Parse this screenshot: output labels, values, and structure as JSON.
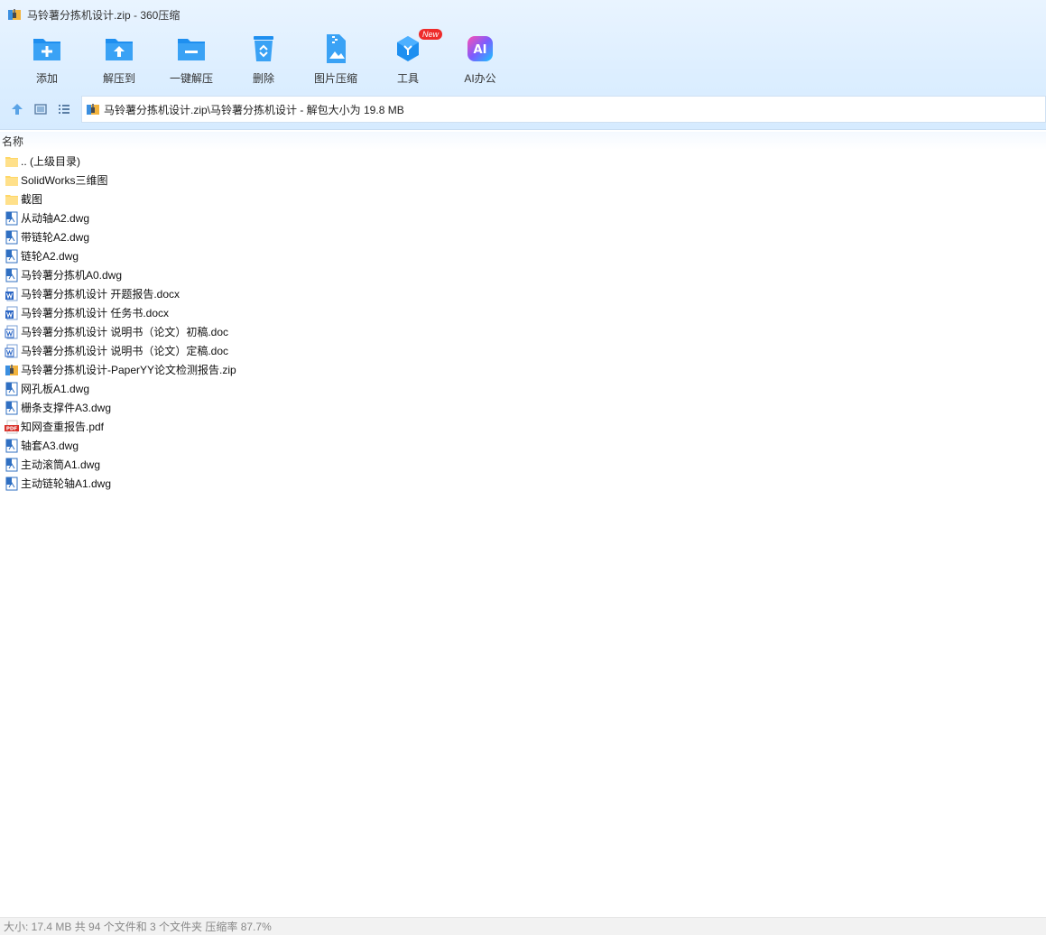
{
  "window": {
    "title": "马铃薯分拣机设计.zip - 360压缩"
  },
  "toolbar": {
    "items": [
      {
        "label": "添加",
        "icon": "add-folder-icon"
      },
      {
        "label": "解压到",
        "icon": "extract-to-icon"
      },
      {
        "label": "一键解压",
        "icon": "one-click-extract-icon"
      },
      {
        "label": "删除",
        "icon": "delete-icon"
      },
      {
        "label": "图片压缩",
        "icon": "image-compress-icon"
      },
      {
        "label": "工具",
        "icon": "tools-icon",
        "badge": "New"
      },
      {
        "label": "AI办公",
        "icon": "ai-office-icon",
        "glyph": "AI"
      }
    ]
  },
  "address": {
    "path": "马铃薯分拣机设计.zip\\马铃薯分拣机设计 - 解包大小为 19.8 MB"
  },
  "list": {
    "column_name": "名称",
    "items": [
      {
        "name": ".. (上级目录)",
        "type": "folder"
      },
      {
        "name": "SolidWorks三维图",
        "type": "folder"
      },
      {
        "name": "截图",
        "type": "folder"
      },
      {
        "name": "从动轴A2.dwg",
        "type": "dwg"
      },
      {
        "name": "带链轮A2.dwg",
        "type": "dwg"
      },
      {
        "name": "链轮A2.dwg",
        "type": "dwg"
      },
      {
        "name": "马铃薯分拣机A0.dwg",
        "type": "dwg"
      },
      {
        "name": "马铃薯分拣机设计 开题报告.docx",
        "type": "docx"
      },
      {
        "name": "马铃薯分拣机设计 任务书.docx",
        "type": "docx"
      },
      {
        "name": "马铃薯分拣机设计 说明书（论文）初稿.doc",
        "type": "doc"
      },
      {
        "name": "马铃薯分拣机设计 说明书（论文）定稿.doc",
        "type": "doc"
      },
      {
        "name": "马铃薯分拣机设计-PaperYY论文检测报告.zip",
        "type": "zip"
      },
      {
        "name": "网孔板A1.dwg",
        "type": "dwg"
      },
      {
        "name": "栅条支撑件A3.dwg",
        "type": "dwg"
      },
      {
        "name": "知网查重报告.pdf",
        "type": "pdf",
        "glyph": "PDF"
      },
      {
        "name": "轴套A3.dwg",
        "type": "dwg"
      },
      {
        "name": "主动滚筒A1.dwg",
        "type": "dwg"
      },
      {
        "name": "主动链轮轴A1.dwg",
        "type": "dwg"
      }
    ]
  },
  "status": {
    "text": "大小: 17.4 MB 共 94 个文件和 3 个文件夹 压缩率 87.7%"
  },
  "colors": {
    "accent": "#1e8ff0",
    "folder": "#ffd766",
    "badge": "#ee2b2b",
    "pdf": "#d9322b",
    "word": "#2b66c5"
  }
}
